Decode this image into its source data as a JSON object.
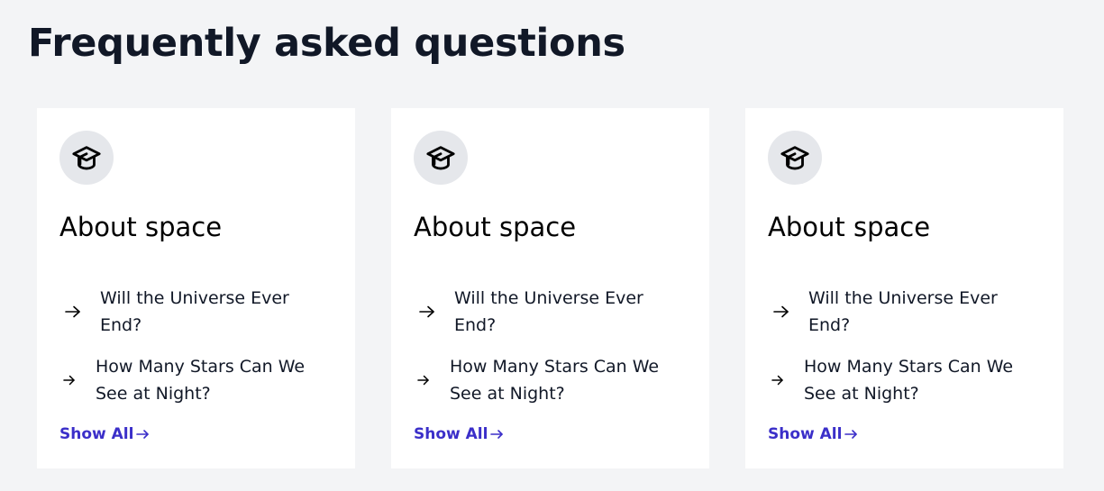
{
  "page": {
    "title": "Frequently asked questions"
  },
  "cards": [
    {
      "icon": "graduation-cap-icon",
      "title": "About space",
      "questions": [
        "Will the Universe Ever End?",
        "How Many Stars Can We See at Night?"
      ],
      "show_all_label": "Show All"
    },
    {
      "icon": "graduation-cap-icon",
      "title": "About space",
      "questions": [
        "Will the Universe Ever End?",
        "How Many Stars Can We See at Night?"
      ],
      "show_all_label": "Show All"
    },
    {
      "icon": "graduation-cap-icon",
      "title": "About space",
      "questions": [
        "Will the Universe Ever End?",
        "How Many Stars Can We See at Night?"
      ],
      "show_all_label": "Show All"
    }
  ],
  "colors": {
    "background": "#f3f4f6",
    "card": "#ffffff",
    "icon_circle": "#e5e7eb",
    "link": "#3b2fc9",
    "text": "#111827"
  }
}
